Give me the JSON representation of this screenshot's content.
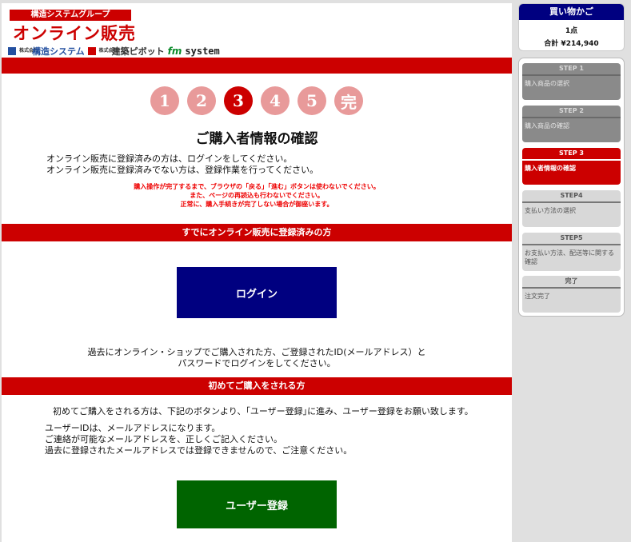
{
  "brand": {
    "group_tag": "構造システムグループ",
    "title": "オンライン販売",
    "corp_small": "株式会社",
    "company1": "構造システム",
    "company2": "建築ピボット",
    "fm": "fm",
    "fm_system": "system"
  },
  "steps": [
    "1",
    "2",
    "3",
    "4",
    "5",
    "完"
  ],
  "page_title": "ご購入者情報の確認",
  "intro": {
    "line1": "オンライン販売に登録済みの方は、ログインをしてください。",
    "line2": "オンライン販売に登録済みでない方は、登録作業を行ってください。"
  },
  "warnings": [
    "購入操作が完了するまで、ブラウザの「戻る」「進む」ボタンは使わないでください。",
    "また、ページの再読込も行わないでください。",
    "正常に、購入手続きが完了しない場合が御座います。"
  ],
  "existing": {
    "header": "すでにオンライン販売に登録済みの方",
    "login_label": "ログイン",
    "desc1": "過去にオンライン・ショップでご購入された方、ご登録されたID(メールアドレス）と",
    "desc2": "パスワードでログインをしてください。"
  },
  "new_user": {
    "header": "初めてご購入をされる方",
    "desc": "初めてご購入をされる方は、下記のボタンより、｢ユーザー登録｣に進み、ユーザー登録をお願い致します。",
    "note1": "ユーザーIDは、メールアドレスになります。",
    "note2": "ご連絡が可能なメールアドレスを、正しくご記入ください。",
    "note3": "過去に登録されたメールアドレスでは登録できませんので、ご注意ください。",
    "register_label": "ユーザー登録"
  },
  "cart": {
    "title": "買い物かご",
    "count": "1点",
    "total": "合計 ¥214,940"
  },
  "side_steps": [
    {
      "head": "STEP 1",
      "body": "購入商品の選択"
    },
    {
      "head": "STEP 2",
      "body": "購入商品の確認"
    },
    {
      "head": "STEP 3",
      "body": "購入者情報の確認"
    },
    {
      "head": "STEP4",
      "body": "支払い方法の選択"
    },
    {
      "head": "STEP5",
      "body": "お支払い方法、配送等に関する確認"
    },
    {
      "head": "完了",
      "body": "注文完了"
    }
  ],
  "colors": {
    "brand_red": "#cc0000",
    "navy": "#000080",
    "green": "#006400",
    "step_pending": "#e89a9a"
  }
}
